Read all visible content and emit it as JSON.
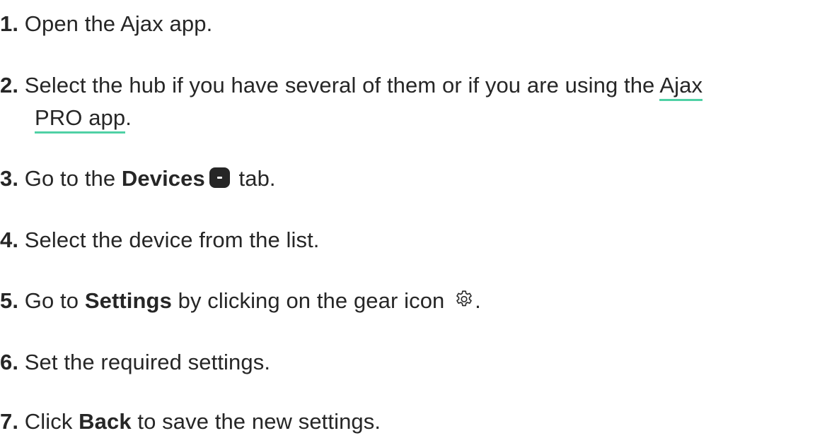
{
  "steps": [
    {
      "number": "1.",
      "text": "Open the Ajax app."
    },
    {
      "number": "2.",
      "text_before": "Select the hub if you have several of them or if you are using the ",
      "link_part1": "Ajax",
      "link_part2": "PRO app",
      "text_after": "."
    },
    {
      "number": "3.",
      "text_before": "Go to the ",
      "bold": "Devices",
      "icon": "devices-tab-icon",
      "text_after": " tab."
    },
    {
      "number": "4.",
      "text": "Select the device from the list."
    },
    {
      "number": "5.",
      "text_before": "Go to ",
      "bold": "Settings",
      "text_middle": " by clicking on the gear icon ",
      "icon": "gear-icon",
      "text_after": "."
    },
    {
      "number": "6.",
      "text": "Set the required settings."
    },
    {
      "number": "7.",
      "text_before": "Click ",
      "bold": "Back",
      "text_after": " to save the new settings."
    }
  ],
  "colors": {
    "text": "#262626",
    "link_underline": "#4fd1a5"
  }
}
